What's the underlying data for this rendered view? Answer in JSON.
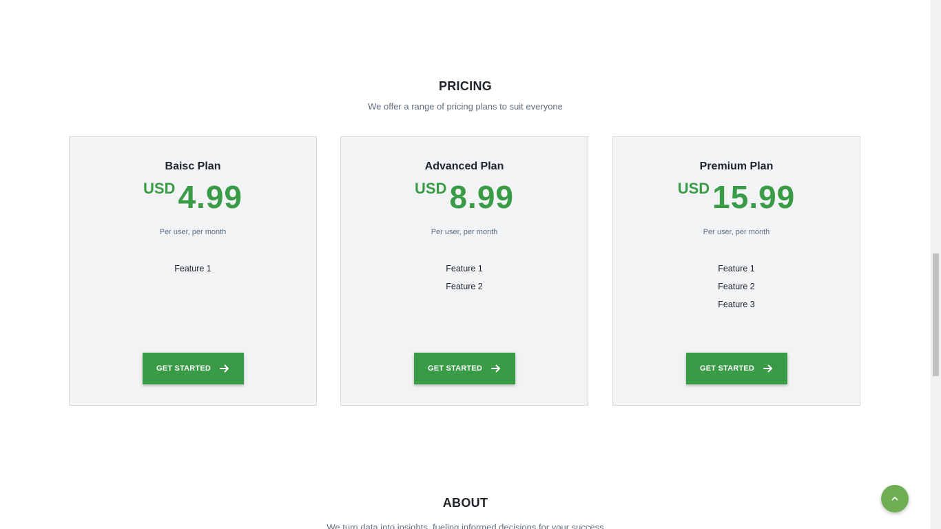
{
  "pricing": {
    "title": "PRICING",
    "subtitle": "We offer a range of pricing plans to suit everyone",
    "plans": [
      {
        "name": "Baisc Plan",
        "currency": "USD",
        "amount": "4.99",
        "period": "Per user, per month",
        "features": [
          "Feature 1"
        ],
        "cta": "GET STARTED"
      },
      {
        "name": "Advanced Plan",
        "currency": "USD",
        "amount": "8.99",
        "period": "Per user, per month",
        "features": [
          "Feature 1",
          "Feature 2"
        ],
        "cta": "GET STARTED"
      },
      {
        "name": "Premium Plan",
        "currency": "USD",
        "amount": "15.99",
        "period": "Per user, per month",
        "features": [
          "Feature 1",
          "Feature 2",
          "Feature 3"
        ],
        "cta": "GET STARTED"
      }
    ]
  },
  "about": {
    "title": "ABOUT",
    "subtitle": "We turn data into insights, fueling informed decisions for your success"
  },
  "icons": {
    "cta_arrow": "arrow-right-icon",
    "scroll_top": "chevron-up-icon"
  },
  "colors": {
    "accent": "#3a9b46",
    "card_bg": "#f1f3f5",
    "scroll_top_bg": "#6fae52"
  }
}
